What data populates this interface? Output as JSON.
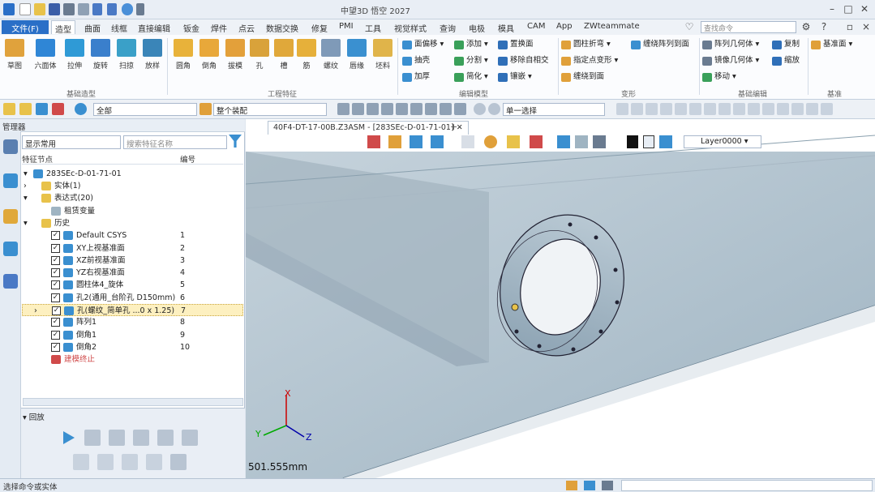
{
  "app": {
    "title": "中望3D 悟空 2027"
  },
  "menu": {
    "file": "文件(F)",
    "tabs": [
      "造型",
      "曲面",
      "线框",
      "直接编辑",
      "钣金",
      "焊件",
      "点云",
      "数据交换",
      "修复",
      "PMI",
      "工具",
      "视觉样式",
      "查询",
      "电极",
      "模具",
      "CAM",
      "App",
      "ZWteammate"
    ],
    "search_placeholder": "查找命令"
  },
  "ribbon": {
    "big_buttons": [
      "草图",
      "六面体",
      "拉伸",
      "旋转",
      "扫掠",
      "放样",
      "圆角",
      "倒角",
      "拔模",
      "孔",
      "槽",
      "筋",
      "螺纹",
      "唇缘",
      "坯料"
    ],
    "small_edit": [
      "面偏移",
      "抽壳",
      "加厚",
      "添加",
      "分割",
      "简化",
      "置换面",
      "移除自相交",
      "镶嵌"
    ],
    "small_change": [
      "圆柱折弯",
      "指定点变形",
      "缠绕到面",
      "缠绕阵列到面"
    ],
    "small_basic": [
      "阵列几何体",
      "镜像几何体",
      "移动",
      "复制",
      "缩放"
    ],
    "small_ref": [
      "基准面"
    ],
    "groups": [
      "基础造型",
      "工程特征",
      "编辑模型",
      "变形",
      "基础编辑",
      "基准"
    ]
  },
  "toolbar2": {
    "filter": "全部",
    "assembly": "整个装配",
    "select_mode": "单一选择"
  },
  "manager": {
    "title": "管理器",
    "filter": "显示常用",
    "search_placeholder": "搜索特征名称",
    "col_feature": "特征节点",
    "col_index": "编号",
    "root": "283SEc-D-01-71-01",
    "items": [
      {
        "label": "实体(1)",
        "num": "",
        "type": "folder",
        "indent": 1,
        "check": false
      },
      {
        "label": "表达式(20)",
        "num": "",
        "type": "folder",
        "indent": 1,
        "check": false
      },
      {
        "label": "租赁变量",
        "num": "",
        "type": "item",
        "indent": 2,
        "check": false
      },
      {
        "label": "历史",
        "num": "",
        "type": "folder",
        "indent": 1,
        "check": false
      },
      {
        "label": "Default CSYS",
        "num": "1",
        "type": "feature",
        "indent": 2,
        "check": true
      },
      {
        "label": "XY上视基准面",
        "num": "2",
        "type": "feature",
        "indent": 2,
        "check": true
      },
      {
        "label": "XZ前视基准面",
        "num": "3",
        "type": "feature",
        "indent": 2,
        "check": true
      },
      {
        "label": "YZ右视基准面",
        "num": "4",
        "type": "feature",
        "indent": 2,
        "check": true
      },
      {
        "label": "圆柱体4_旋体",
        "num": "5",
        "type": "feature",
        "indent": 2,
        "check": true
      },
      {
        "label": "孔2(通用_台阶孔 D150mm)",
        "num": "6",
        "type": "feature",
        "indent": 2,
        "check": true
      },
      {
        "label": "孔(螺纹_简单孔 ...0 x 1.25)",
        "num": "7",
        "type": "feature",
        "indent": 2,
        "check": true,
        "selected": true
      },
      {
        "label": "阵列1",
        "num": "8",
        "type": "feature",
        "indent": 2,
        "check": true
      },
      {
        "label": "倒角1",
        "num": "9",
        "type": "feature",
        "indent": 2,
        "check": true
      },
      {
        "label": "倒角2",
        "num": "10",
        "type": "feature",
        "indent": 2,
        "check": true
      },
      {
        "label": "建模终止",
        "num": "",
        "type": "end",
        "indent": 2,
        "check": false
      }
    ],
    "playback_title": "回放"
  },
  "viewport": {
    "doc_tab": "40F4-DT-17-00B.Z3ASM - [283SEc-D-01-71-01]",
    "layer": "Layer0000",
    "measure": "501.555mm",
    "axes": [
      "X",
      "Y",
      "Z"
    ]
  },
  "status": {
    "text": "选择命令或实体"
  },
  "colors": {
    "accent": "#2a6fc7",
    "selection": "#fdf0c0",
    "part": "#8a9aa6"
  }
}
